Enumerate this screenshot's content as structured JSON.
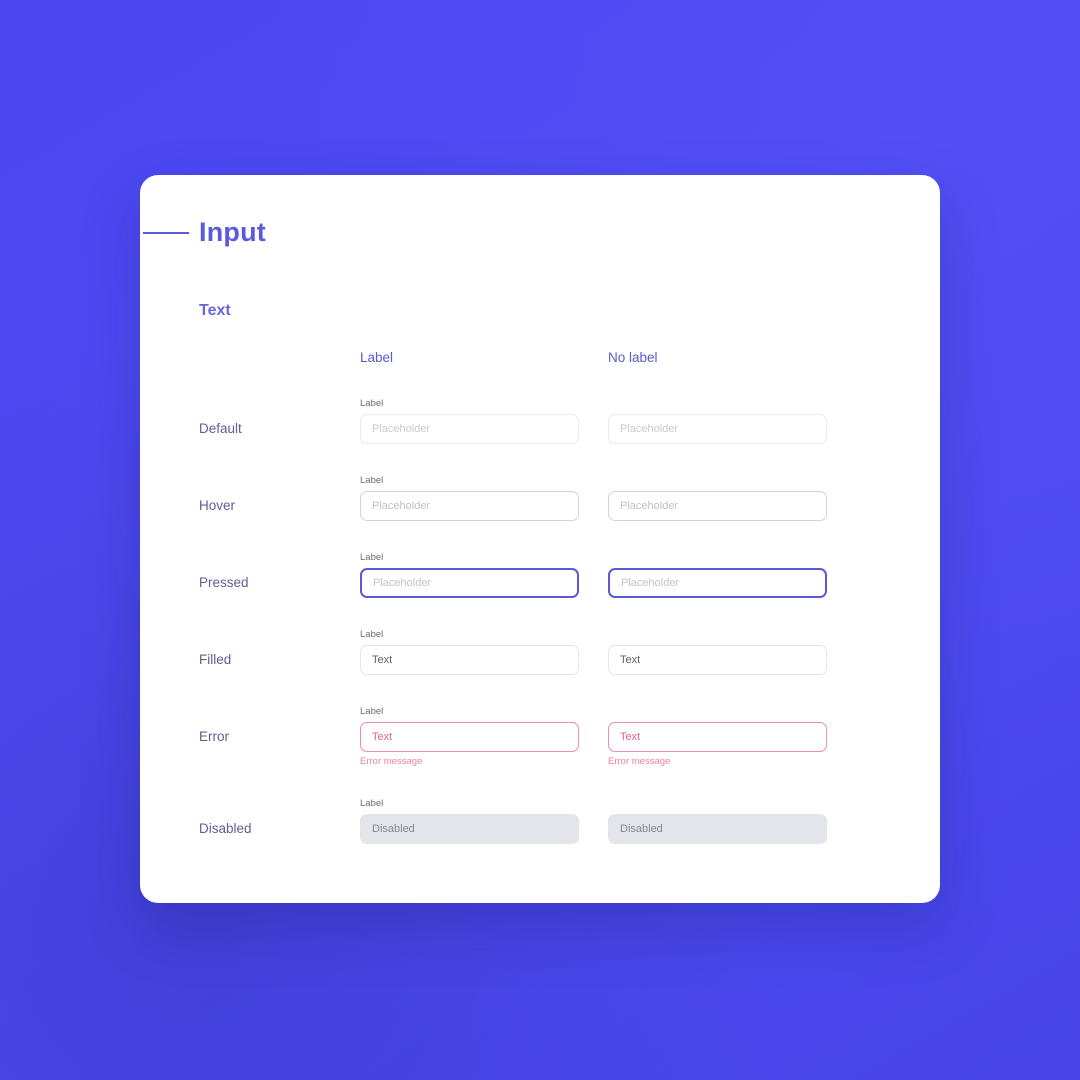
{
  "background": {
    "color": "#4a49f0"
  },
  "card": {
    "title": "Input",
    "section_title": "Text",
    "accent_color": "#5b59e0",
    "error_color": "#e8628f"
  },
  "columns": [
    {
      "id": "label",
      "header": "Label",
      "has_label": true
    },
    {
      "id": "no-label",
      "header": "No label",
      "has_label": false
    }
  ],
  "field_label": "Label",
  "rows": [
    {
      "id": "default",
      "row_label": "Default",
      "state": "default",
      "value": "Placeholder",
      "placeholder": "Placeholder",
      "helper": ""
    },
    {
      "id": "hover",
      "row_label": "Hover",
      "state": "hover",
      "value": "Placeholder",
      "placeholder": "Placeholder",
      "helper": ""
    },
    {
      "id": "pressed",
      "row_label": "Pressed",
      "state": "pressed",
      "value": "Placeholder",
      "placeholder": "Placeholder",
      "helper": ""
    },
    {
      "id": "filled",
      "row_label": "Filled",
      "state": "filled",
      "value": "Text",
      "placeholder": "Placeholder",
      "helper": ""
    },
    {
      "id": "error",
      "row_label": "Error",
      "state": "error",
      "value": "Text",
      "placeholder": "Placeholder",
      "helper": "Error message"
    },
    {
      "id": "disabled",
      "row_label": "Disabled",
      "state": "disabled",
      "value": "Disabled",
      "placeholder": "Disabled",
      "helper": ""
    }
  ]
}
